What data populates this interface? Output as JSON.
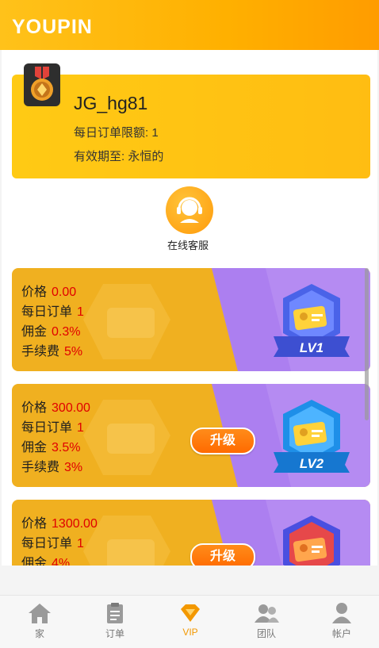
{
  "app": {
    "logo": "YOUPIN"
  },
  "profile": {
    "username": "JG_hg81",
    "daily_limit": "每日订单限额: 1",
    "expiry": "有效期至: 永恒的"
  },
  "support": {
    "label": "在线客服"
  },
  "vip_cards": [
    {
      "price_label": "价格",
      "price": "0.00",
      "daily_label": "每日订单",
      "daily": "1",
      "commission_label": "佣金",
      "commission": "0.3%",
      "fee_label": "手续费",
      "fee": "5%",
      "badge": "LV1",
      "upgrade": ""
    },
    {
      "price_label": "价格",
      "price": "300.00",
      "daily_label": "每日订单",
      "daily": "1",
      "commission_label": "佣金",
      "commission": "3.5%",
      "fee_label": "手续费",
      "fee": "3%",
      "badge": "LV2",
      "upgrade": "升级"
    },
    {
      "price_label": "价格",
      "price": "1300.00",
      "daily_label": "每日订单",
      "daily": "1",
      "commission_label": "佣金",
      "commission": "4%",
      "badge": "",
      "upgrade": "升级"
    }
  ],
  "nav": {
    "items": [
      {
        "label": "家",
        "icon": "home-icon"
      },
      {
        "label": "订单",
        "icon": "clipboard-icon"
      },
      {
        "label": "VIP",
        "icon": "diamond-icon"
      },
      {
        "label": "团队",
        "icon": "team-icon"
      },
      {
        "label": "帐户",
        "icon": "user-icon"
      }
    ],
    "active": "VIP"
  },
  "colors": {
    "brand": "#ffb000",
    "value_red": "#e00000",
    "active_nav": "#f39800"
  }
}
